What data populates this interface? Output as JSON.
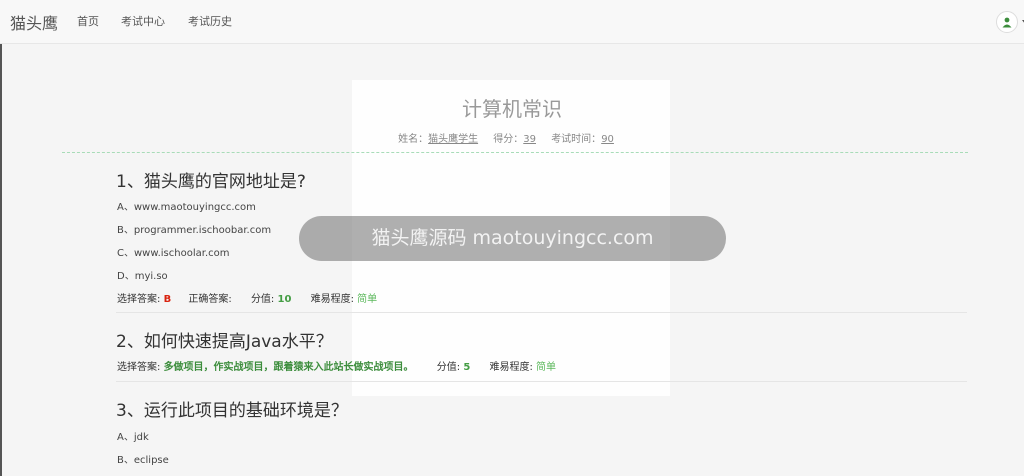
{
  "navbar": {
    "brand": "猫头鹰",
    "links": [
      "首页",
      "考试中心",
      "考试历史"
    ]
  },
  "exam": {
    "title": "计算机常识",
    "name_label": "姓名：",
    "name_value": "猫头鹰学生",
    "score_label": "得分：",
    "score_value": "39",
    "time_label": "考试时间：",
    "time_value": "90"
  },
  "questions": [
    {
      "title": "1、猫头鹰的官网地址是?",
      "options": [
        "A、www.maotouyingcc.com",
        "B、programmer.ischoobar.com",
        "C、www.ischoolar.com",
        "D、myi.so"
      ],
      "selected_label": "选择答案:",
      "selected": "B",
      "correct_label": "正确答案:",
      "score_label": "分值:",
      "score": "10",
      "difficulty_label": "难易程度:",
      "difficulty": "简单"
    },
    {
      "title": "2、如何快速提高Java水平？",
      "selected_label": "选择答案:",
      "answer": "多做项目，作实战项目，跟着猿来入此站长做实战项目。",
      "score_label": "分值:",
      "score": "5",
      "difficulty_label": "难易程度:",
      "difficulty": "简单"
    },
    {
      "title": "3、运行此项目的基础环境是？",
      "options": [
        "A、jdk",
        "B、eclipse"
      ]
    }
  ],
  "watermark": "猫头鹰源码 maotouyingcc.com",
  "colors": {
    "accent_red": "#d9230f",
    "accent_green": "#449d44",
    "divider_dashed": "#a8dcb8"
  }
}
